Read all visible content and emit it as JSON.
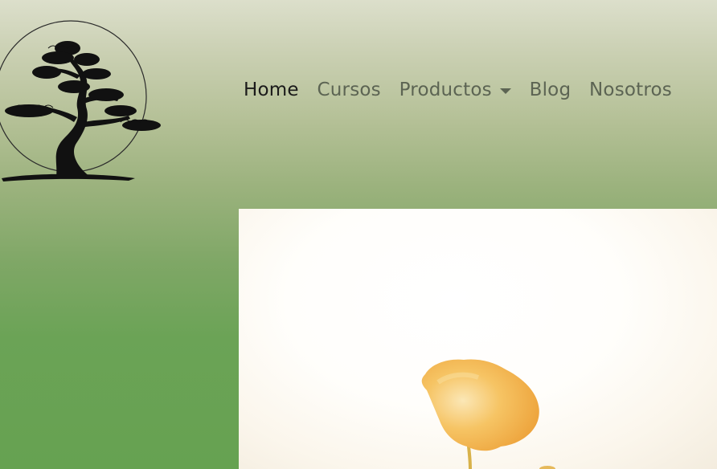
{
  "brand": {
    "logo_icon": "bonsai-tree-logo"
  },
  "nav": {
    "items": [
      {
        "label": "Home",
        "active": true
      },
      {
        "label": "Cursos"
      },
      {
        "label": "Productos",
        "has_dropdown": true
      },
      {
        "label": "Blog"
      },
      {
        "label": "Nosotros"
      }
    ]
  },
  "hero": {
    "image": "yellow-poppy-flower-photo"
  },
  "colors": {
    "nav_active": "#1a1a1a",
    "nav_text": "#5c6453",
    "gradient_top": "#dcdfcb",
    "gradient_bottom": "#66a251",
    "flower": "#f2b24a"
  }
}
